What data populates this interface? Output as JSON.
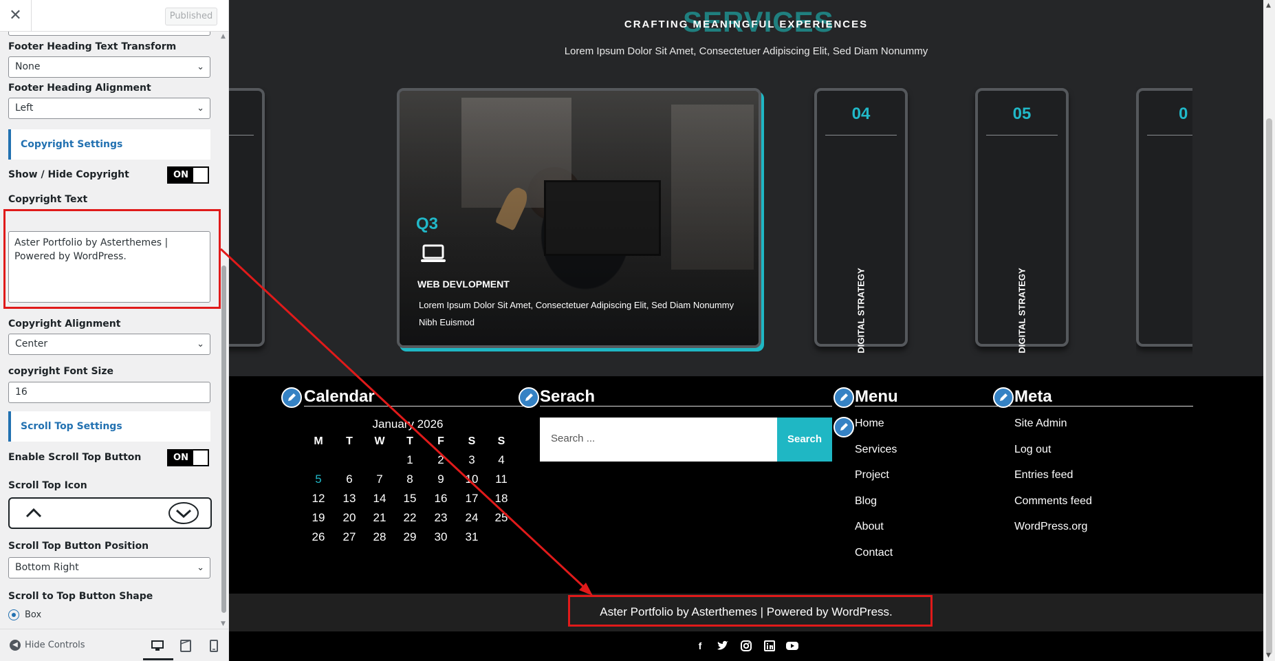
{
  "panel": {
    "close_glyph": "✕",
    "publish_label": "Published",
    "footer_heading_transform": {
      "label": "Footer Heading Text Transform",
      "value": "None"
    },
    "footer_heading_alignment": {
      "label": "Footer Heading Alignment",
      "value": "Left"
    },
    "copyright_section": "Copyright Settings",
    "show_hide_copyright": {
      "label": "Show / Hide Copyright",
      "value": "ON"
    },
    "copyright_text": {
      "label": "Copyright Text",
      "value": "Aster Portfolio by Asterthemes | Powered by WordPress."
    },
    "copyright_alignment": {
      "label": "Copyright Alignment",
      "value": "Center"
    },
    "copyright_font_size": {
      "label": "copyright Font Size",
      "value": "16"
    },
    "scroll_top_section": "Scroll Top Settings",
    "enable_scroll_top": {
      "label": "Enable Scroll Top Button",
      "value": "ON"
    },
    "scroll_top_icon": {
      "label": "Scroll Top Icon"
    },
    "scroll_top_position": {
      "label": "Scroll Top Button Position",
      "value": "Bottom Right"
    },
    "scroll_top_shape": {
      "label": "Scroll to Top Button Shape",
      "option": "Box"
    },
    "hide_controls": "Hide Controls"
  },
  "hero": {
    "ghost_text": "SERVICES",
    "tagline": "CRAFTING MEANINGFUL EXPERIENCES",
    "subline": "Lorem Ipsum Dolor Sit Amet, Consectetuer Adipiscing Elit, Sed Diam Nonummy",
    "feature": {
      "number": "Q3",
      "title": "WEB DEVLOPMENT",
      "description": "Lorem Ipsum Dolor Sit Amet, Consectetuer Adipiscing Elit, Sed Diam Nonummy Nibh Euismod"
    },
    "cards": [
      {
        "number": "04",
        "label": "DIGITAL STRATEGY"
      },
      {
        "number": "05",
        "label": "DIGITAL STRATEGY"
      },
      {
        "number": "0"
      }
    ],
    "accent": "#21b8c8"
  },
  "widgets": {
    "calendar": {
      "title": "Calendar",
      "caption": "January 2026",
      "days": [
        "M",
        "T",
        "W",
        "T",
        "F",
        "S",
        "S"
      ],
      "rows": [
        [
          "",
          "",
          "",
          "1",
          "2",
          "3",
          "4"
        ],
        [
          "5",
          "6",
          "7",
          "8",
          "9",
          "10",
          "11"
        ],
        [
          "12",
          "13",
          "14",
          "15",
          "16",
          "17",
          "18"
        ],
        [
          "19",
          "20",
          "21",
          "22",
          "23",
          "24",
          "25"
        ],
        [
          "26",
          "27",
          "28",
          "29",
          "30",
          "31",
          ""
        ]
      ],
      "highlight": "5"
    },
    "search": {
      "title": "Serach",
      "placeholder": "Search ...",
      "button": "Search"
    },
    "menu": {
      "title": "Menu",
      "items": [
        "Home",
        "Services",
        "Project",
        "Blog",
        "About",
        "Contact"
      ]
    },
    "meta": {
      "title": "Meta",
      "items": [
        "Site Admin",
        "Log out",
        "Entries feed",
        "Comments feed",
        "WordPress.org"
      ]
    }
  },
  "footer": {
    "copyright": "Aster Portfolio by Asterthemes | Powered by WordPress.",
    "social": [
      "facebook-icon",
      "twitter-icon",
      "instagram-icon",
      "linkedin-icon",
      "youtube-icon"
    ]
  },
  "colors": {
    "highlight_box": "#e01a1a",
    "section_accent": "#2271b1"
  }
}
